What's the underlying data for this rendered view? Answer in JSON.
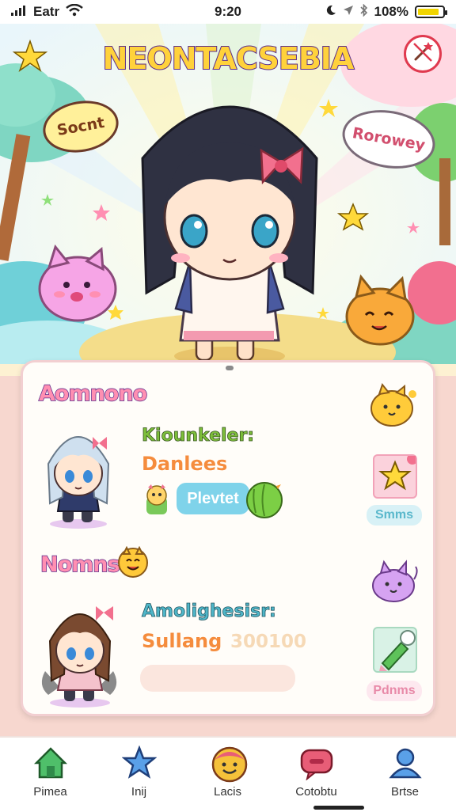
{
  "status_bar": {
    "carrier": "Eatr",
    "time": "9:20",
    "battery_percent": "108%",
    "battery_fill_fraction": 0.85
  },
  "scene": {
    "title": "NEONTACSEBIA",
    "bubble_left": "Socnt",
    "bubble_right": "Rorowey"
  },
  "panel": {
    "section1": {
      "title": "Aomnono",
      "label1": "Kiounkeler:",
      "label2": "Danlees",
      "pill": "Plevtet"
    },
    "section2": {
      "title": "Nomns",
      "label1": "Amolighesisr:",
      "label2": "Sullang",
      "score": "300100"
    },
    "side": {
      "btn1_label": "Smms",
      "btn2_label": "Pdnms"
    }
  },
  "tabs": [
    {
      "label": "Pimea",
      "icon": "house-icon",
      "color": "#4fbf6a"
    },
    {
      "label": "Inij",
      "icon": "star-icon",
      "color": "#5aa0e8"
    },
    {
      "label": "Lacis",
      "icon": "smiley-icon",
      "color": "#f5c13a"
    },
    {
      "label": "Cotobtu",
      "icon": "chat-icon",
      "color": "#e85d77"
    },
    {
      "label": "Brtse",
      "icon": "person-icon",
      "color": "#5aa0e8"
    }
  ]
}
